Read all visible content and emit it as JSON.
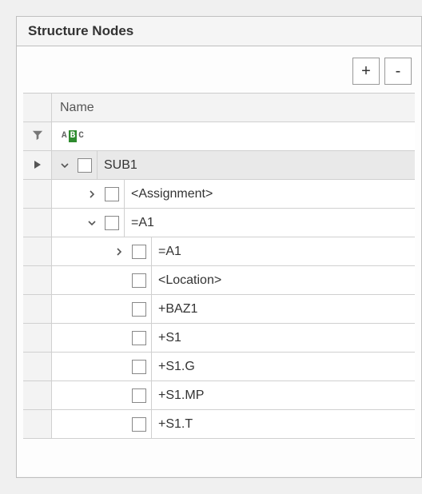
{
  "panel": {
    "title": "Structure Nodes"
  },
  "toolbar": {
    "add_label": "+",
    "remove_label": "-"
  },
  "columns": {
    "name": "Name"
  },
  "filter": {
    "badge_a": "A",
    "badge_b": "B",
    "badge_c": "C"
  },
  "tree": {
    "root": {
      "label": "SUB1",
      "expanded": true,
      "children": [
        {
          "label": "<Assignment>",
          "expanded": false,
          "has_children": true
        },
        {
          "label": "=A1",
          "expanded": true,
          "has_children": true,
          "children": [
            {
              "label": "=A1",
              "expanded": false,
              "has_children": true
            },
            {
              "label": "<Location>",
              "has_children": false
            },
            {
              "label": "+BAZ1",
              "has_children": false
            },
            {
              "label": "+S1",
              "has_children": false
            },
            {
              "label": "+S1.G",
              "has_children": false
            },
            {
              "label": "+S1.MP",
              "has_children": false
            },
            {
              "label": "+S1.T",
              "has_children": false
            }
          ]
        }
      ]
    }
  }
}
